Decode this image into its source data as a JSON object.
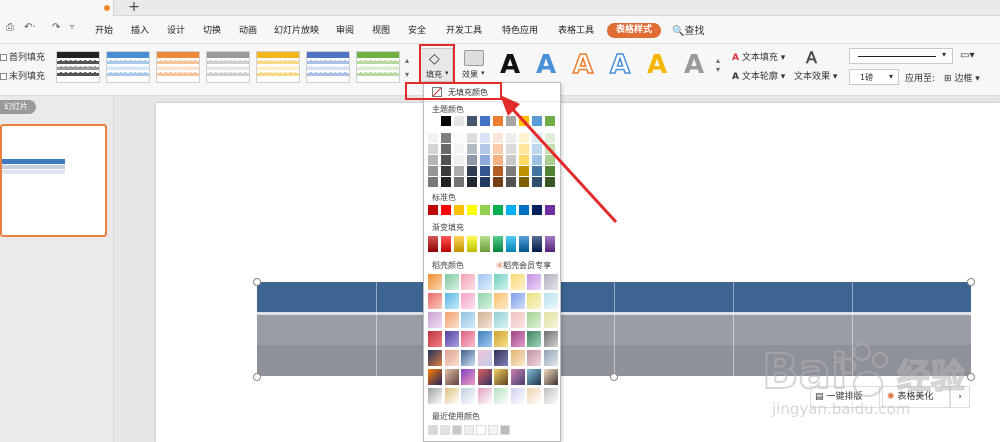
{
  "tabs": {
    "new_tab": "+"
  },
  "quick_access": {
    "undo": "↶·",
    "redo": "↷"
  },
  "menu": {
    "items": [
      "开始",
      "插入",
      "设计",
      "切换",
      "动画",
      "幻灯片放映",
      "审阅",
      "视图",
      "安全",
      "开发工具",
      "特色应用",
      "表格工具"
    ],
    "active": "表格样式",
    "search": "查找"
  },
  "ribbon": {
    "first_col_fill": "首列填充",
    "last_col_fill": "末列填充",
    "fill_button": "填充",
    "effect_button": "效果",
    "text_fill": "文本填充",
    "text_outline": "文本轮廓",
    "text_effect": "文本效果",
    "line_weight": "1磅",
    "apply_to": "应用至:",
    "border": "边框",
    "art_letter": "A"
  },
  "left_pane": {
    "slides_label": "幻灯片"
  },
  "popup": {
    "no_fill": "无填充颜色",
    "theme_colors": "主题颜色",
    "standard_colors": "标准色",
    "gradient_fill": "渐变填充",
    "daoke_colors": "稻壳颜色",
    "member": "稻壳会员专享",
    "recent": "最近使用颜色",
    "theme_row": [
      "#ffffff",
      "#000000",
      "#e7e6e6",
      "#44546a",
      "#4472c4",
      "#ed7d31",
      "#a5a5a5",
      "#ffc000",
      "#5b9bd5",
      "#70ad47"
    ],
    "standard_row": [
      "#c00000",
      "#ff0000",
      "#ffc000",
      "#ffff00",
      "#92d050",
      "#00b050",
      "#00b0f0",
      "#0070c0",
      "#002060",
      "#7030a0"
    ]
  },
  "bottom_buttons": {
    "one_click": "一键排版",
    "beautify": "表格美化",
    "more": "›"
  },
  "watermark": {
    "brand": "Bai",
    "brand2": "经验",
    "url": "jingyan.baidu.com"
  },
  "colors": {
    "accent": "#e06d36",
    "annotation": "#e32b2b",
    "table_header": "#3e6591",
    "table_body": "#9a9da6"
  }
}
